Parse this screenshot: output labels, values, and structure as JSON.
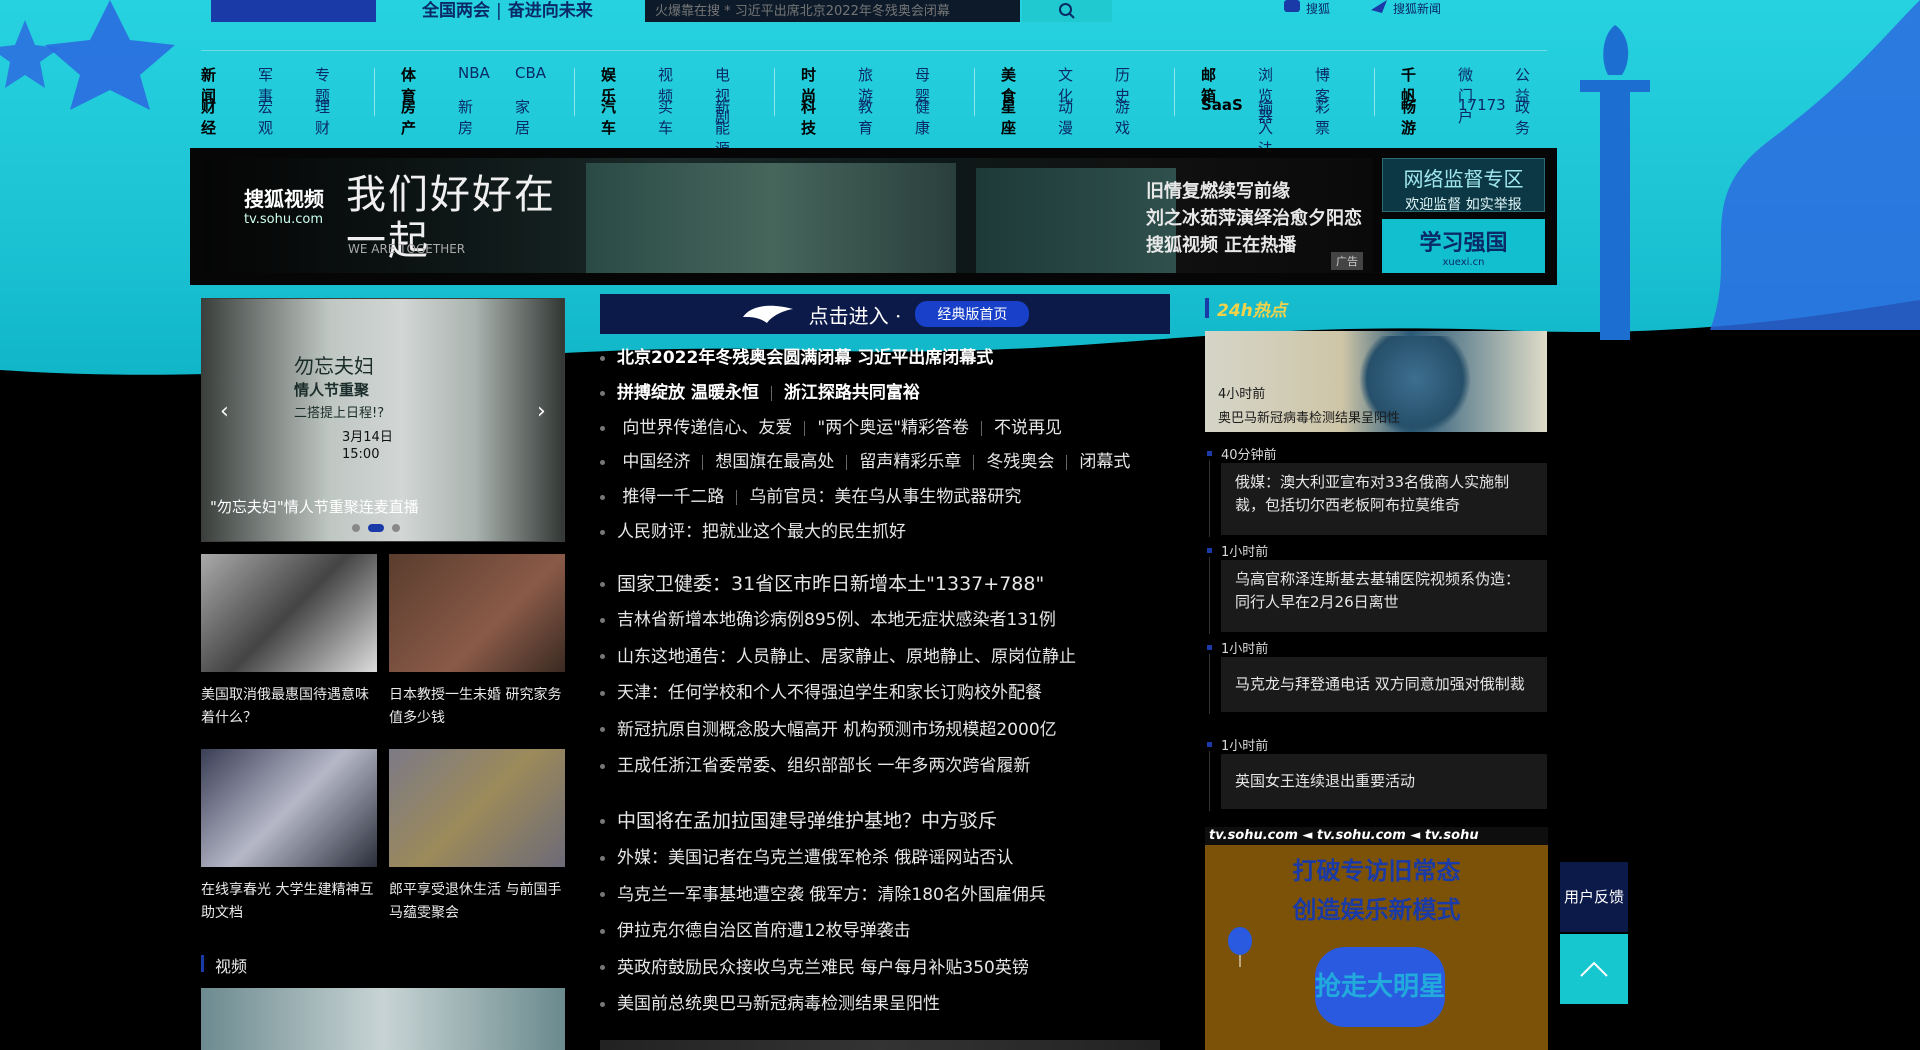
{
  "header": {
    "slogan_left": "全国两会",
    "slogan_sep": "|",
    "slogan_right": "奋进向未来",
    "search_placeholder": "火爆靠在搜 * 习近平出席北京2022年冬残奥会闭幕",
    "tools": [
      "搜狐",
      "搜狐新闻"
    ]
  },
  "nav": {
    "groups": [
      {
        "row1": [
          "新闻",
          "军事",
          "专题"
        ],
        "row2": [
          "财经",
          "宏观",
          "理财"
        ]
      },
      {
        "row1": [
          "体育",
          "NBA",
          "CBA"
        ],
        "row2": [
          "房产",
          "新房",
          "家居"
        ]
      },
      {
        "row1": [
          "娱乐",
          "视频",
          "电视剧"
        ],
        "row2": [
          "汽车",
          "买车",
          "新能源"
        ]
      },
      {
        "row1": [
          "时尚",
          "旅游",
          "母婴"
        ],
        "row2": [
          "科技",
          "教育",
          "健康"
        ]
      },
      {
        "row1": [
          "美食",
          "文化",
          "历史"
        ],
        "row2": [
          "星座",
          "动漫",
          "游戏"
        ]
      },
      {
        "row1": [
          "邮箱",
          "浏览器",
          "博客"
        ],
        "row2": [
          "SaaS",
          "输入法",
          "彩票"
        ]
      },
      {
        "row1": [
          "千帆",
          "微门户",
          "公益"
        ],
        "row2": [
          "畅游",
          "17173",
          "政务"
        ]
      }
    ]
  },
  "banner": {
    "brand": "搜狐视频",
    "brand_url_text": "tv.sohu.com",
    "headline": "我们好好在一起",
    "headline_en": "WE ARE TOGETHER",
    "tagline": [
      "旧情复燃续写前缘",
      "刘之冰茹萍演绎治愈夕阳恋",
      "搜狐视频 正在热播"
    ],
    "ad_tag": "广告",
    "side1_title": "网络监督专区",
    "side1_sub": "欢迎监督 如实举报",
    "side2_title": "学习强国",
    "side2_sub": "xuexi.cn"
  },
  "carousel": {
    "title": "\"勿忘夫妇\"情人节重聚连麦直播",
    "poster_lines": [
      "勿忘夫妇",
      "情人节重聚",
      "二搭提上日程!?"
    ],
    "poster_date": "3月14日",
    "poster_time": "15:00",
    "prev": "‹",
    "next": "›"
  },
  "thumbs": [
    {
      "caption": "美国取消俄最惠国待遇意味着什么？"
    },
    {
      "caption": "日本教授一生未婚 研究家务值多少钱"
    },
    {
      "caption": "在线享春光 大学生建精神互助文档"
    },
    {
      "caption": "郎平享受退休生活 与前国手马蕴雯聚会"
    }
  ],
  "video_section": {
    "label": "视频"
  },
  "enter": {
    "text": "点击进入 ·",
    "classic_label": "经典版首页"
  },
  "news": {
    "line1": "北京2022年冬残奥会圆满闭幕 习近平出席闭幕式",
    "line2a": "拼搏绽放 温暖永恒",
    "line2b": "浙江探路共同富裕",
    "line3": [
      "向世界传递信心、友爱",
      "\"两个奥运\"精彩答卷",
      "不说再见"
    ],
    "line4": [
      "中国经济",
      "想国旗在最高处",
      "留声精彩乐章",
      "冬残奥会",
      "闭幕式"
    ],
    "line5": [
      "推得一千二路",
      "乌前官员：美在乌从事生物武器研究"
    ],
    "line6": "人民财评：把就业这个最大的民生抓好",
    "group2_head": "国家卫健委：31省区市昨日新增本土\"1337+788\"",
    "group2": [
      "吉林省新增本地确诊病例895例、本地无症状感染者131例",
      "山东这地通告：人员静止、居家静止、原地静止、原岗位静止",
      "天津：任何学校和个人不得强迫学生和家长订购校外配餐",
      "新冠抗原自测概念股大幅高开 机构预测市场规模超2000亿",
      "王成任浙江省委常委、组织部部长 一年多两次跨省履新"
    ],
    "group3_head": "中国将在孟加拉国建导弹维护基地？中方驳斥",
    "group3": [
      "外媒：美国记者在乌克兰遭俄军枪杀 俄辟谣网站否认",
      "乌克兰一军事基地遭空袭 俄军方：清除180名外国雇佣兵",
      "伊拉克尔德自治区首府遭12枚导弹袭击",
      "英政府鼓励民众接收乌克兰难民 每户每月补贴350英镑",
      "美国前总统奥巴马新冠病毒检测结果呈阳性"
    ]
  },
  "hot": {
    "label": "24h热点",
    "top": {
      "time": "4小时前",
      "title": "奥巴马新冠病毒检测结果呈阳性"
    },
    "items": [
      {
        "time": "40分钟前",
        "title": "俄媒：澳大利亚宣布对33名俄商人实施制裁，包括切尔西老板阿布拉莫维奇"
      },
      {
        "time": "1小时前",
        "title": "乌高官称泽连斯基去基辅医院视频系伪造：同行人早在2月26日离世"
      },
      {
        "time": "1小时前",
        "title": "马克龙与拜登通电话 双方同意加强对俄制裁"
      },
      {
        "time": "1小时前",
        "title": "英国女王连续退出重要活动"
      }
    ]
  },
  "right_ad": {
    "strip": "tv.sohu.com ◄ tv.sohu.com ◄ tv.sohu",
    "line1": "打破专访旧常态",
    "line2": "创造娱乐新模式",
    "badge": "抢走大明星"
  },
  "float": {
    "feedback": "用户反馈"
  }
}
